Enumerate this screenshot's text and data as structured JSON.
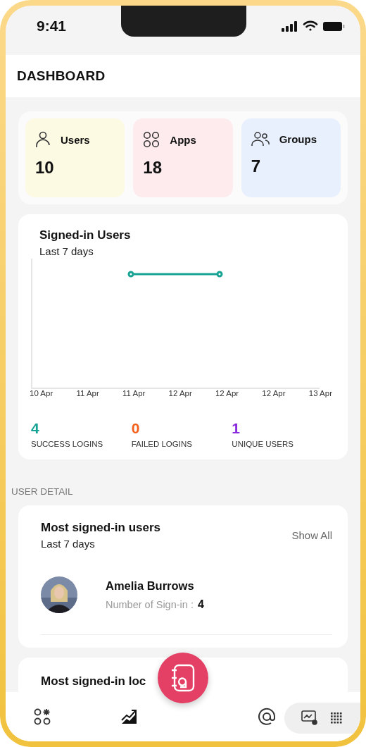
{
  "status_bar": {
    "time": "9:41"
  },
  "header": {
    "title": "DASHBOARD"
  },
  "stats": [
    {
      "kind": "user",
      "label": "Users",
      "value": "10",
      "color": "#fdfae4"
    },
    {
      "kind": "apps",
      "label": "Apps",
      "value": "18",
      "color": "#fdebee"
    },
    {
      "kind": "group",
      "label": "Groups",
      "value": "7",
      "color": "#e8f0fd"
    }
  ],
  "signin_chart": {
    "title": "Signed-in Users",
    "subtitle": "Last 7 days",
    "x_labels": [
      "10 Apr",
      "11 Apr",
      "11 Apr",
      "12 Apr",
      "12 Apr",
      "12 Apr",
      "13 Apr"
    ],
    "metrics": [
      {
        "value": "4",
        "label": "SUCCESS LOGINS",
        "color": "#15a394"
      },
      {
        "value": "0",
        "label": "FAILED LOGINS",
        "color": "#f2601c"
      },
      {
        "value": "1",
        "label": "UNIQUE USERS",
        "color": "#8b2be0"
      }
    ]
  },
  "section_label": "USER DETAIL",
  "most_users": {
    "title": "Most signed-in users",
    "subtitle": "Last 7 days",
    "action": "Show All",
    "users": [
      {
        "name": "Amelia Burrows",
        "count_label": "Number of Sign-in :",
        "count": "4"
      }
    ]
  },
  "next_card": {
    "title": "Most signed-in loc"
  }
}
